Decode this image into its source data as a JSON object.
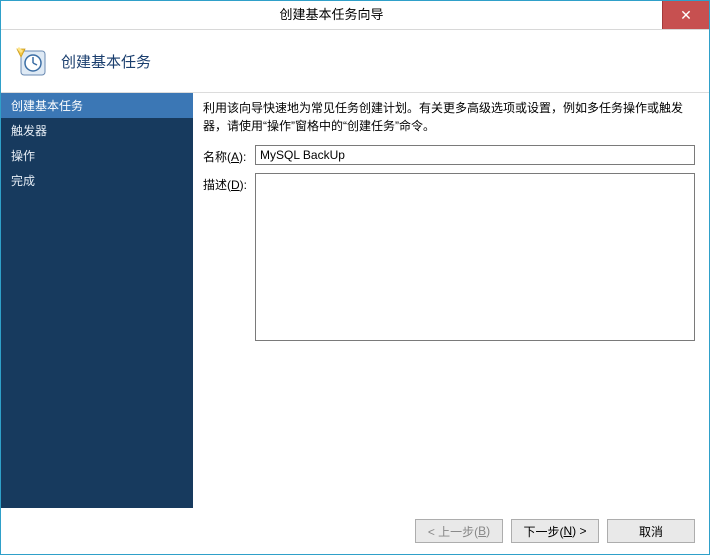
{
  "window": {
    "title": "创建基本任务向导"
  },
  "header": {
    "heading": "创建基本任务"
  },
  "sidebar": {
    "steps": [
      {
        "label": "创建基本任务",
        "active": true
      },
      {
        "label": "触发器",
        "active": false
      },
      {
        "label": "操作",
        "active": false
      },
      {
        "label": "完成",
        "active": false
      }
    ]
  },
  "content": {
    "intro": "利用该向导快速地为常见任务创建计划。有关更多高级选项或设置，例如多任务操作或触发器，请使用“操作”窗格中的“创建任务”命令。",
    "name_label_pre": "名称(",
    "name_label_hot": "A",
    "name_label_post": "):",
    "name_value": "MySQL BackUp",
    "desc_label_pre": "描述(",
    "desc_label_hot": "D",
    "desc_label_post": "):",
    "desc_value": ""
  },
  "footer": {
    "back_pre": "< 上一步(",
    "back_hot": "B",
    "back_post": ")",
    "next_pre": "下一步(",
    "next_hot": "N",
    "next_post": ") >",
    "cancel": "取消"
  }
}
